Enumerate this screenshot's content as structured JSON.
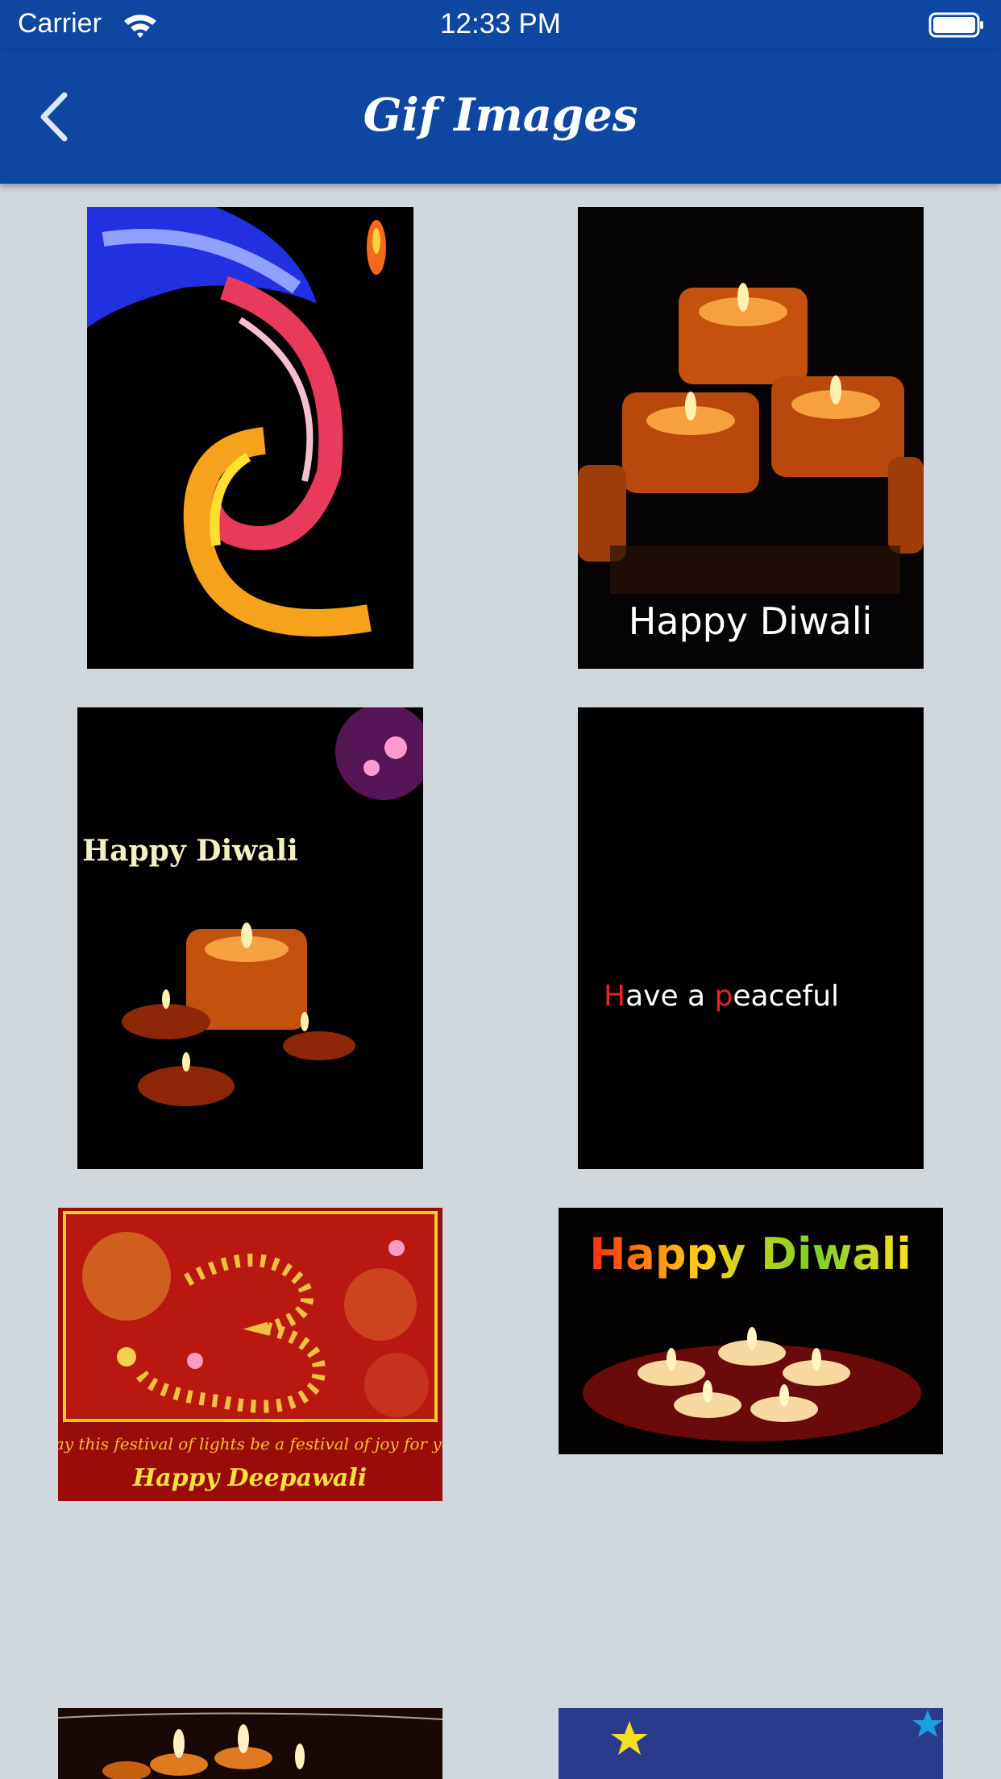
{
  "status": {
    "carrier": "Carrier",
    "time": "12:33 PM"
  },
  "nav": {
    "title": "Gif Images",
    "back_icon": "chevron-left-icon"
  },
  "colors": {
    "bar": "#0d47a1",
    "background": "#d0d7dd"
  },
  "gallery": {
    "items": [
      {
        "name": "swirl-ganesha-gif",
        "caption": ""
      },
      {
        "name": "candles-gif",
        "caption": "Happy Diwali"
      },
      {
        "name": "diya-fireworks-gif",
        "caption": "Happy Diwali"
      },
      {
        "name": "peaceful-text-gif",
        "caption_parts": [
          "H",
          "ave a ",
          "p",
          "eaceful"
        ]
      },
      {
        "name": "om-diyas-card",
        "caption": "May this festival of lights be a festival of joy for you",
        "caption2": "Happy Deepawali"
      },
      {
        "name": "happy-diwali-candles",
        "caption": "Happy Diwali"
      },
      {
        "name": "diyas-bottom-left",
        "caption": ""
      },
      {
        "name": "stars-bottom-right",
        "caption": ""
      }
    ]
  }
}
